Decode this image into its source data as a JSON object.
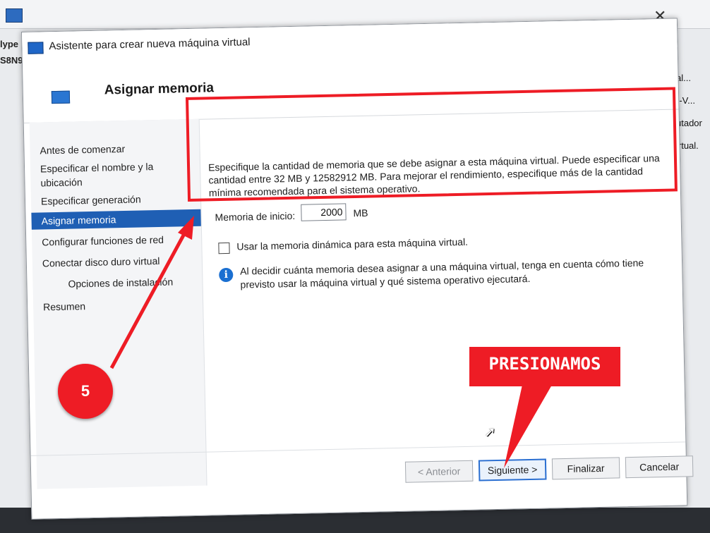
{
  "background": {
    "left_fragments": [
      "lype",
      "S8N9"
    ],
    "right_items": [
      "al...",
      "r-V...",
      "utador",
      "irtual."
    ]
  },
  "wizard": {
    "title": "Asistente para crear nueva máquina virtual",
    "header_title": "Asignar memoria",
    "nav": [
      "Antes de comenzar",
      "Especificar el nombre y la ubicación",
      "Especificar generación",
      "Asignar memoria",
      "Configurar funciones de red",
      "Conectar disco duro virtual",
      "Opciones de instalación",
      "Resumen"
    ],
    "description": "Especifique la cantidad de memoria que se debe asignar a esta máquina virtual. Puede especificar una cantidad entre 32 MB y 12582912 MB. Para mejorar el rendimiento, especifique más de la cantidad mínima recomendada para el sistema operativo.",
    "memory_label": "Memoria de inicio:",
    "memory_value": "2000",
    "memory_unit": "MB",
    "dynamic_memory_label": "Usar la memoria dinámica para esta máquina virtual.",
    "info_icon_glyph": "i",
    "info_text": "Al decidir cuánta memoria desea asignar a una máquina virtual, tenga en cuenta cómo tiene previsto usar la máquina virtual y qué sistema operativo ejecutará.",
    "buttons": {
      "back": "< Anterior",
      "next": "Siguiente >",
      "finish": "Finalizar",
      "cancel": "Cancelar"
    }
  },
  "annotations": {
    "step_number": "5",
    "callout_text": "PRESIONAMOS",
    "accent_color": "#ee1c25"
  }
}
